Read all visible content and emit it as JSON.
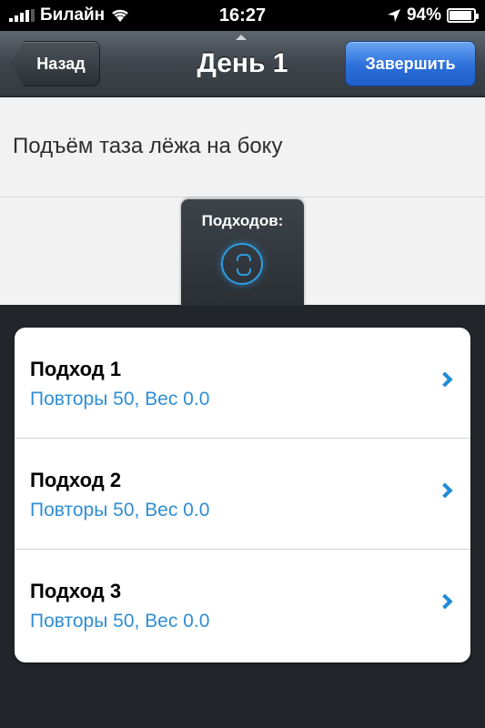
{
  "status_bar": {
    "carrier": "Билайн",
    "time": "16:27",
    "battery_percent": "94%",
    "battery_level": 0.94
  },
  "nav": {
    "back_label": "Назад",
    "title": "День 1",
    "done_label": "Завершить"
  },
  "exercise": {
    "name": "Подъём таза лёжа на боку"
  },
  "sets_tab": {
    "label": "Подходов:",
    "icon": "stepper-icon"
  },
  "sets": [
    {
      "title": "Подход 1",
      "detail": "Повторы 50, Вес 0.0"
    },
    {
      "title": "Подход 2",
      "detail": "Повторы 50, Вес 0.0"
    },
    {
      "title": "Подход 3",
      "detail": "Повторы 50, Вес 0.0"
    }
  ],
  "colors": {
    "accent_blue": "#2f8ed4",
    "done_button": "#2b6fd9"
  }
}
